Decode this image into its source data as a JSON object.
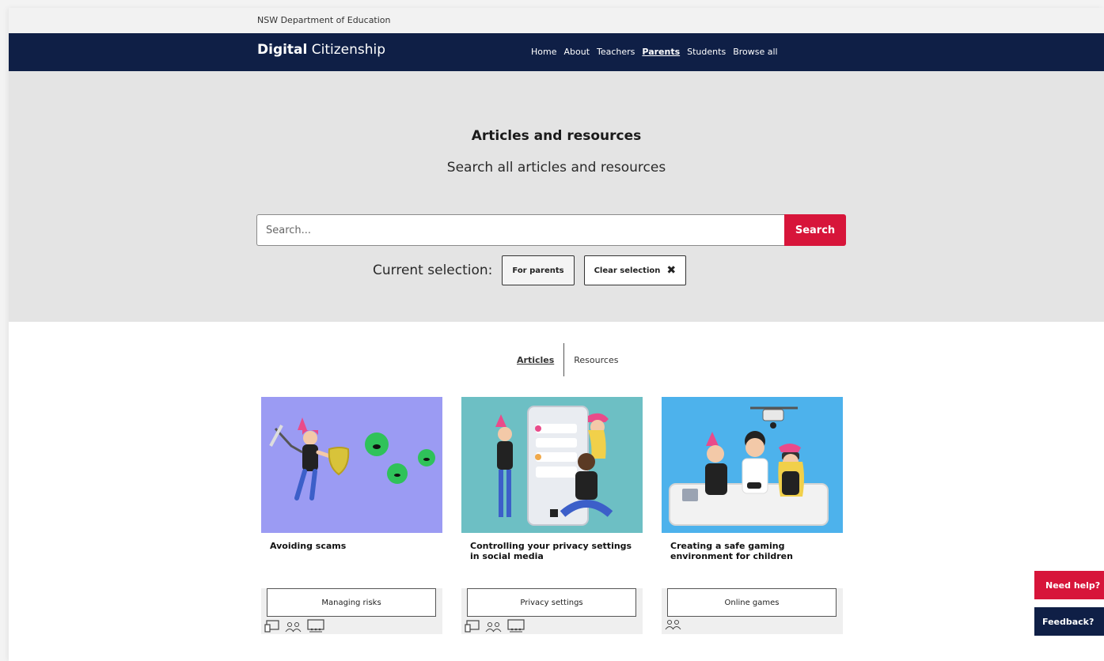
{
  "header": {
    "department": "NSW Department of Education",
    "logo_bold": "Digital",
    "logo_regular": " Citizenship",
    "nav": [
      {
        "label": "Home",
        "active": false
      },
      {
        "label": "About",
        "active": false
      },
      {
        "label": "Teachers",
        "active": false
      },
      {
        "label": "Parents",
        "active": true
      },
      {
        "label": "Students",
        "active": false
      },
      {
        "label": "Browse all",
        "active": false
      }
    ]
  },
  "hero": {
    "title": "Articles and resources",
    "subtitle": "Search all articles and resources",
    "search_placeholder": "Search...",
    "search_button": "Search",
    "selection_label": "Current selection:",
    "selection_chip": "For parents",
    "clear_label": "Clear selection",
    "clear_icon": "✖"
  },
  "tabs": [
    {
      "label": "Articles",
      "active": true
    },
    {
      "label": "Resources",
      "active": false
    }
  ],
  "cards": [
    {
      "title": "Avoiding scams",
      "tag": "Managing risks",
      "image_icon": "scam-illustration",
      "bg_color": "#9b9bf3",
      "audience_icons": [
        "device-icon",
        "people-icon",
        "classroom-icon"
      ]
    },
    {
      "title": "Controlling your privacy settings in social media",
      "tag": "Privacy settings",
      "image_icon": "privacy-illustration",
      "bg_color": "#6dbfc4",
      "audience_icons": [
        "device-icon",
        "people-icon",
        "classroom-icon"
      ]
    },
    {
      "title": "Creating a safe gaming environment for children",
      "tag": "Online games",
      "image_icon": "gaming-illustration",
      "bg_color": "#4db2ec",
      "audience_icons": [
        "people-icon"
      ]
    }
  ],
  "floating": {
    "help": "Need help?",
    "feedback": "Feedback?"
  },
  "colors": {
    "navy": "#0f1f46",
    "red": "#d7153a",
    "hero_bg": "#e4e4e4"
  }
}
